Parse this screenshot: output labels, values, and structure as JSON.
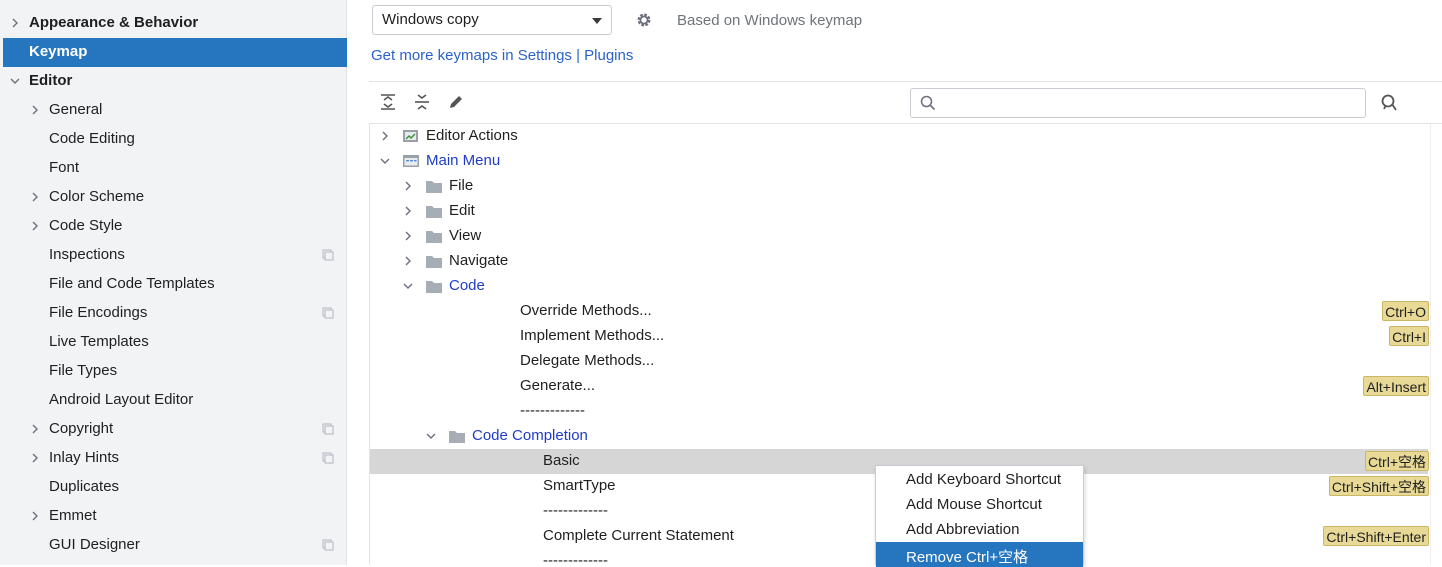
{
  "sidebar": {
    "items": [
      {
        "label": "Appearance & Behavior",
        "bold": true,
        "indent": 0,
        "chevron": "right"
      },
      {
        "label": "Keymap",
        "bold": true,
        "indent": 0,
        "chevron": "",
        "selected": true
      },
      {
        "label": "Editor",
        "bold": true,
        "indent": 0,
        "chevron": "down"
      },
      {
        "label": "General",
        "indent": 1,
        "chevron": "right"
      },
      {
        "label": "Code Editing",
        "indent": 1,
        "chevron": ""
      },
      {
        "label": "Font",
        "indent": 1,
        "chevron": ""
      },
      {
        "label": "Color Scheme",
        "indent": 1,
        "chevron": "right"
      },
      {
        "label": "Code Style",
        "indent": 1,
        "chevron": "right"
      },
      {
        "label": "Inspections",
        "indent": 1,
        "chevron": "",
        "project_icon": true
      },
      {
        "label": "File and Code Templates",
        "indent": 1,
        "chevron": ""
      },
      {
        "label": "File Encodings",
        "indent": 1,
        "chevron": "",
        "project_icon": true
      },
      {
        "label": "Live Templates",
        "indent": 1,
        "chevron": ""
      },
      {
        "label": "File Types",
        "indent": 1,
        "chevron": ""
      },
      {
        "label": "Android Layout Editor",
        "indent": 1,
        "chevron": ""
      },
      {
        "label": "Copyright",
        "indent": 1,
        "chevron": "right",
        "project_icon": true
      },
      {
        "label": "Inlay Hints",
        "indent": 1,
        "chevron": "right",
        "project_icon": true
      },
      {
        "label": "Duplicates",
        "indent": 1,
        "chevron": ""
      },
      {
        "label": "Emmet",
        "indent": 1,
        "chevron": "right"
      },
      {
        "label": "GUI Designer",
        "indent": 1,
        "chevron": "",
        "project_icon": true
      }
    ]
  },
  "keymap": {
    "selected": "Windows copy",
    "based_on": "Based on Windows keymap",
    "get_more_text": "Get more keymaps in Settings",
    "get_more_sep": " | ",
    "plugins_link": "Plugins"
  },
  "search": {
    "placeholder": "",
    "value": ""
  },
  "tree": [
    {
      "label": "Editor Actions",
      "level": 0,
      "chevron": "right",
      "icon": "editor-actions-icon"
    },
    {
      "label": "Main Menu",
      "level": 0,
      "chevron": "down",
      "icon": "main-menu-icon",
      "blue": true
    },
    {
      "label": "File",
      "level": 1,
      "chevron": "right",
      "icon": "folder-icon"
    },
    {
      "label": "Edit",
      "level": 1,
      "chevron": "right",
      "icon": "folder-icon"
    },
    {
      "label": "View",
      "level": 1,
      "chevron": "right",
      "icon": "folder-icon"
    },
    {
      "label": "Navigate",
      "level": 1,
      "chevron": "right",
      "icon": "folder-icon"
    },
    {
      "label": "Code",
      "level": 1,
      "chevron": "down",
      "icon": "folder-icon",
      "blue": true
    },
    {
      "label": "Override Methods...",
      "level": 2,
      "shortcuts": [
        "Ctrl+O"
      ]
    },
    {
      "label": "Implement Methods...",
      "level": 2,
      "shortcuts": [
        "Ctrl+I"
      ]
    },
    {
      "label": "Delegate Methods...",
      "level": 2
    },
    {
      "label": "Generate...",
      "level": 2,
      "shortcuts": [
        "Alt+Insert"
      ]
    },
    {
      "label": "-------------",
      "level": 2
    },
    {
      "label": "Code Completion",
      "level": 2,
      "chevron": "down",
      "icon": "folder-icon",
      "blue": true
    },
    {
      "label": "Basic",
      "level": 3,
      "shortcuts": [
        "Ctrl+空格"
      ],
      "highlight": true
    },
    {
      "label": "SmartType",
      "level": 3,
      "shortcuts": [
        "Ctrl+Shift+空格"
      ]
    },
    {
      "label": "-------------",
      "level": 3
    },
    {
      "label": "Complete Current Statement",
      "level": 3,
      "shortcuts": [
        "Ctrl+Shift+Enter"
      ]
    },
    {
      "label": "-------------",
      "level": 3
    }
  ],
  "context_menu": {
    "items": [
      {
        "label": "Add Keyboard Shortcut"
      },
      {
        "label": "Add Mouse Shortcut"
      },
      {
        "label": "Add Abbreviation"
      },
      {
        "label": "Remove Ctrl+空格",
        "selected": true
      }
    ]
  },
  "colors": {
    "accent": "#2675bf",
    "link": "#2a63c8",
    "modified": "#1f3cc8",
    "shortcut_bg": "#e8da96"
  }
}
